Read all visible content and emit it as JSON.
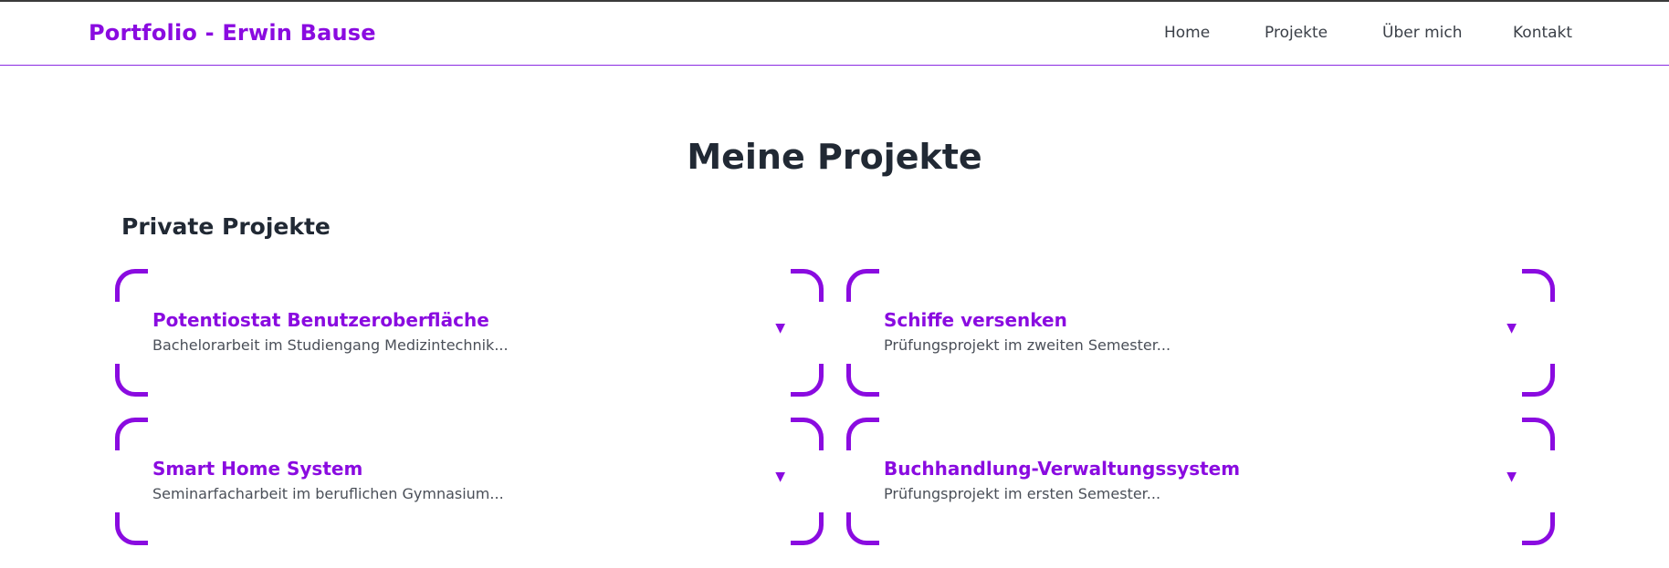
{
  "header": {
    "brand": "Portfolio - Erwin Bause",
    "nav": [
      "Home",
      "Projekte",
      "Über mich",
      "Kontakt"
    ]
  },
  "main": {
    "title": "Meine Projekte",
    "section_title": "Private Projekte",
    "projects": [
      {
        "title": "Potentiostat Benutzeroberfläche",
        "desc": "Bachelorarbeit im Studiengang Medizintechnik..."
      },
      {
        "title": "Schiffe versenken",
        "desc": "Prüfungsprojekt im zweiten Semester..."
      },
      {
        "title": "Smart Home System",
        "desc": "Seminarfacharbeit im beruflichen Gymnasium..."
      },
      {
        "title": "Buchhandlung-Verwaltungssystem",
        "desc": "Prüfungsprojekt im ersten Semester..."
      }
    ],
    "toggle_icon": "▼"
  },
  "colors": {
    "accent": "#8a0be0",
    "heading": "#212934",
    "text": "#4a4f58"
  }
}
